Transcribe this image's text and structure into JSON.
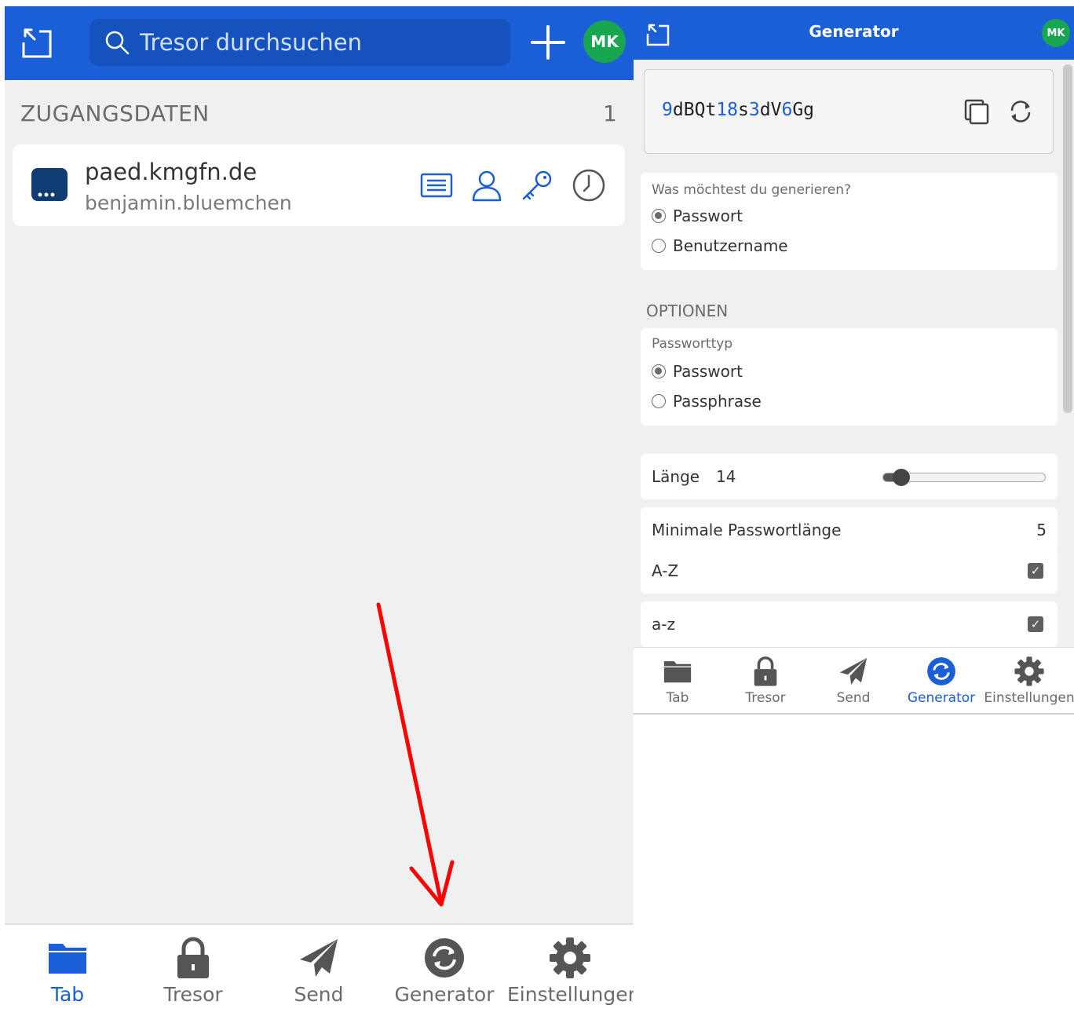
{
  "left": {
    "search": {
      "placeholder": "Tresor durchsuchen"
    },
    "avatar_initials": "MK",
    "section": {
      "title": "ZUGANGSDATEN",
      "count": "1"
    },
    "login_item": {
      "title": "paed.kmgfn.de",
      "username": "benjamin.bluemchen"
    },
    "nav": [
      {
        "label": "Tab",
        "icon": "folder-icon",
        "active": true
      },
      {
        "label": "Tresor",
        "icon": "lock-icon",
        "active": false
      },
      {
        "label": "Send",
        "icon": "send-icon",
        "active": false
      },
      {
        "label": "Generator",
        "icon": "generator-icon",
        "active": false
      },
      {
        "label": "Einstellungen",
        "icon": "gear-icon",
        "active": false
      }
    ]
  },
  "right": {
    "header_title": "Generator",
    "avatar_initials": "MK",
    "generated_password": "9dBQt18s3dV6Gg",
    "what_to_generate": {
      "question": "Was möchtest du generieren?",
      "options": [
        {
          "label": "Passwort",
          "selected": true
        },
        {
          "label": "Benutzername",
          "selected": false
        }
      ]
    },
    "options_heading": "OPTIONEN",
    "password_type": {
      "caption": "Passworttyp",
      "options": [
        {
          "label": "Passwort",
          "selected": true
        },
        {
          "label": "Passphrase",
          "selected": false
        }
      ]
    },
    "length": {
      "label": "Länge",
      "value": "14",
      "slider_fraction": 0.11
    },
    "min_length": {
      "label": "Minimale Passwortlänge",
      "value": "5"
    },
    "uppercase": {
      "label": "A-Z",
      "checked": true
    },
    "lowercase": {
      "label": "a-z",
      "checked": true
    },
    "nav": [
      {
        "label": "Tab",
        "icon": "folder-icon",
        "active": false
      },
      {
        "label": "Tresor",
        "icon": "lock-icon",
        "active": false
      },
      {
        "label": "Send",
        "icon": "send-icon",
        "active": false
      },
      {
        "label": "Generator",
        "icon": "generator-icon",
        "active": true
      },
      {
        "label": "Einstellungen",
        "icon": "gear-icon",
        "active": false
      }
    ]
  },
  "colors": {
    "brand_blue": "#1a5fd7",
    "avatar_green": "#18a651",
    "annotation_red": "#ff0000"
  }
}
